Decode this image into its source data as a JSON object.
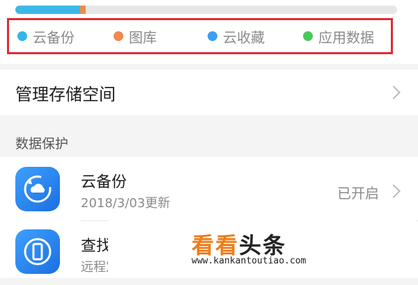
{
  "storage": {
    "segments": [
      {
        "name": "cloud-backup",
        "fraction": 0.17,
        "color": "#3cb9e6"
      },
      {
        "name": "gallery",
        "fraction": 0.015,
        "color": "#f08a4a"
      }
    ],
    "legend": [
      {
        "label": "云备份",
        "color": "#35b6e7"
      },
      {
        "label": "图库",
        "color": "#f0894e"
      },
      {
        "label": "云收藏",
        "color": "#3e9ff0"
      },
      {
        "label": "应用数据",
        "color": "#4cc75a"
      }
    ]
  },
  "manage_storage": {
    "label": "管理存储空间"
  },
  "section": {
    "title": "数据保护"
  },
  "items": [
    {
      "title": "云备份",
      "subtitle": "2018/3/03更新",
      "status": "已开启"
    },
    {
      "title": "查找",
      "subtitle": "远程定位和保护"
    }
  ],
  "watermark": {
    "brand_kk": "看看",
    "brand_tt": "头条",
    "url": "www.kankantoutiao.com"
  },
  "colors": {
    "accent_red_border": "#dd2c32",
    "icon_blue": "#2f86f0"
  }
}
